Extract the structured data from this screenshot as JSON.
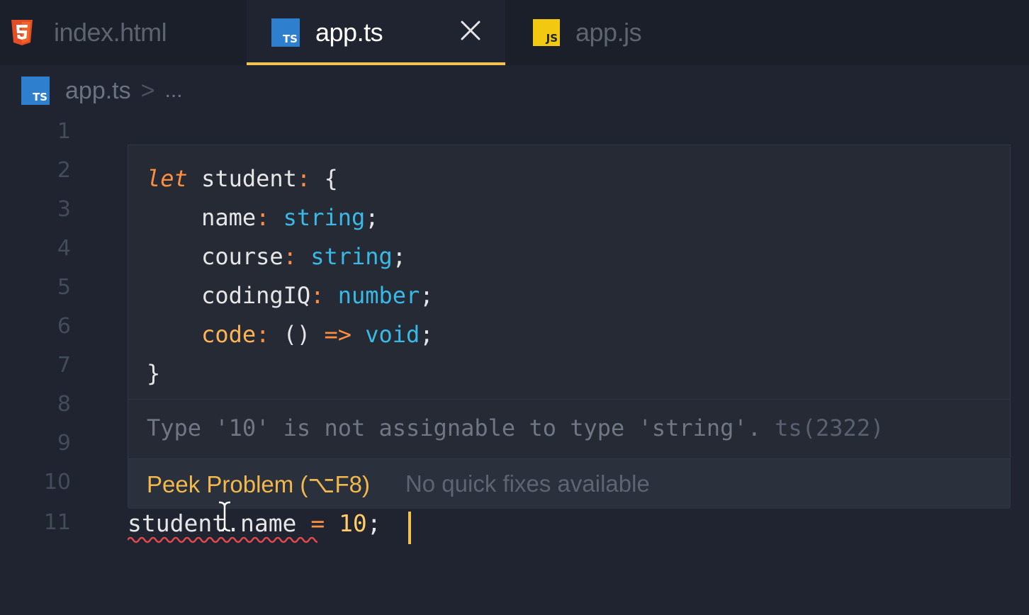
{
  "tabs": [
    {
      "label": "index.html",
      "icon": "html5-icon",
      "active": false
    },
    {
      "label": "app.ts",
      "icon": "typescript-icon",
      "badge": "TS",
      "active": true
    },
    {
      "label": "app.js",
      "icon": "javascript-icon",
      "badge": "JS",
      "active": false
    }
  ],
  "breadcrumb": {
    "badge": "TS",
    "file": "app.ts",
    "separator": ">",
    "more": "..."
  },
  "line_numbers": [
    "1",
    "2",
    "3",
    "4",
    "5",
    "6",
    "7",
    "8",
    "9",
    "10",
    "11"
  ],
  "hover": {
    "code": {
      "line1": {
        "kw": "let",
        "ident": "student",
        "colon": ":",
        "brace": "{"
      },
      "line2": {
        "prop": "name",
        "colon": ":",
        "type": "string",
        "semi": ";"
      },
      "line3": {
        "prop": "course",
        "colon": ":",
        "type": "string",
        "semi": ";"
      },
      "line4": {
        "prop": "codingIQ",
        "colon": ":",
        "type": "number",
        "semi": ";"
      },
      "line5": {
        "prop": "code",
        "colon": ":",
        "parens": "()",
        "arrow": "=>",
        "type": "void",
        "semi": ";"
      },
      "line6": {
        "brace": "}"
      }
    },
    "diagnostic": "Type '10' is not assignable to type 'string'.",
    "diagnostic_code": "ts(2322)",
    "peek_label": "Peek Problem (⌥F8)",
    "no_fixes": "No quick fixes available"
  },
  "editor_line_11": {
    "ident": "student",
    "dot": ".",
    "prop": "name",
    "op": "=",
    "num": "10",
    "semi": ";"
  },
  "colors": {
    "accent": "#f2c14e",
    "keyword": "#ff8f40",
    "type": "#39bae6",
    "error_squiggle": "#e0474f"
  }
}
